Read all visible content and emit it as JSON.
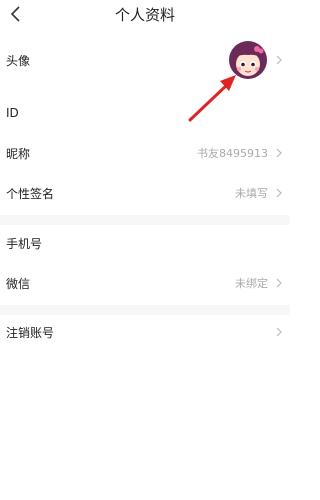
{
  "header": {
    "title": "个人资料",
    "back_icon": "back-chevron-icon"
  },
  "profile": {
    "avatar_label": "头像",
    "id_label": "ID",
    "nickname_label": "昵称",
    "nickname_value": "书友8495913",
    "signature_label": "个性签名",
    "signature_value": "未填写",
    "phone_label": "手机号",
    "wechat_label": "微信",
    "wechat_value": "未绑定",
    "deregister_label": "注销账号"
  },
  "colors": {
    "annotation_arrow": "#e02424",
    "separator": "#f7f7f7",
    "muted_text": "#aaaaaa"
  }
}
